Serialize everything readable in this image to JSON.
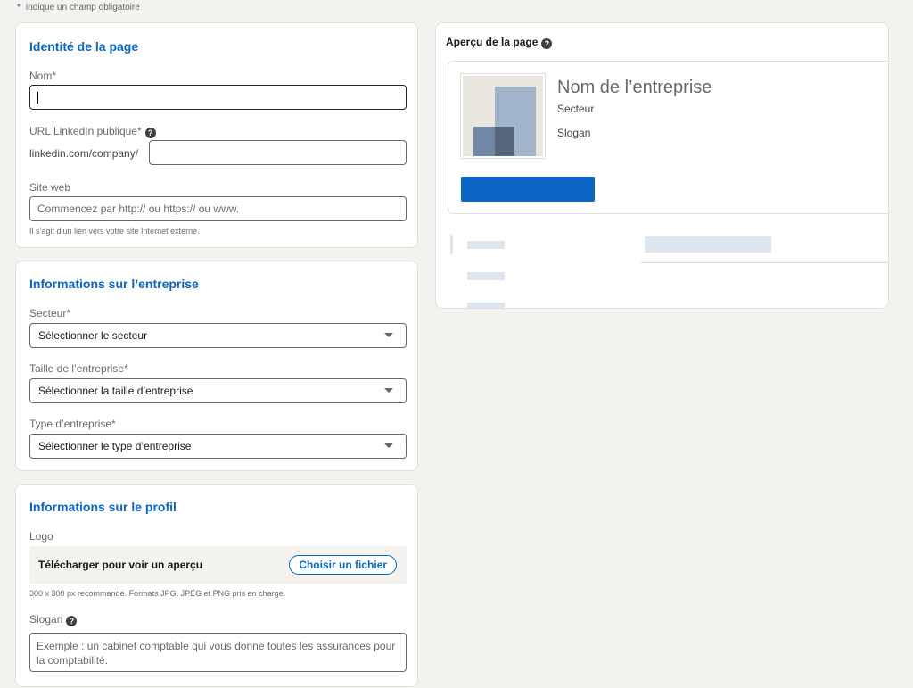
{
  "required_note": {
    "star": "*",
    "text": "indique un champ obligatoire"
  },
  "identity": {
    "title": "Identité de la page",
    "name_label": "Nom*",
    "url_label": "URL LinkedIn publique*",
    "url_prefix": "linkedin.com/company/",
    "website_label": "Site web",
    "website_placeholder": "Commencez par http:// ou https:// ou www.",
    "website_hint": "Il s’agit d’un lien vers votre site Internet externe."
  },
  "company": {
    "title": "Informations sur l’entreprise",
    "sector_label": "Secteur*",
    "sector_value": "Sélectionner le secteur",
    "size_label": "Taille de l’entreprise*",
    "size_value": "Sélectionner la taille d’entreprise",
    "type_label": "Type d’entreprise*",
    "type_value": "Sélectionner le type d’entreprise"
  },
  "profile": {
    "title": "Informations sur le profil",
    "logo_label": "Logo",
    "upload_text": "Télécharger pour voir un aperçu",
    "upload_button": "Choisir un fichier",
    "logo_hint": "300 x 300 px recommandé. Formats JPG, JPEG et PNG pris en charge.",
    "slogan_label": "Slogan",
    "slogan_placeholder": "Exemple : un cabinet comptable qui vous donne toutes les assurances pour la comptabilité."
  },
  "preview": {
    "title": "Aperçu de la page",
    "company_name": "Nom de l’entreprise",
    "sector": "Secteur",
    "slogan": "Slogan"
  },
  "icons": {
    "help": "help-icon",
    "dropdown": "chevron-down-icon"
  },
  "colors": {
    "accent": "#0a66c2",
    "background": "#f3f2ef"
  }
}
